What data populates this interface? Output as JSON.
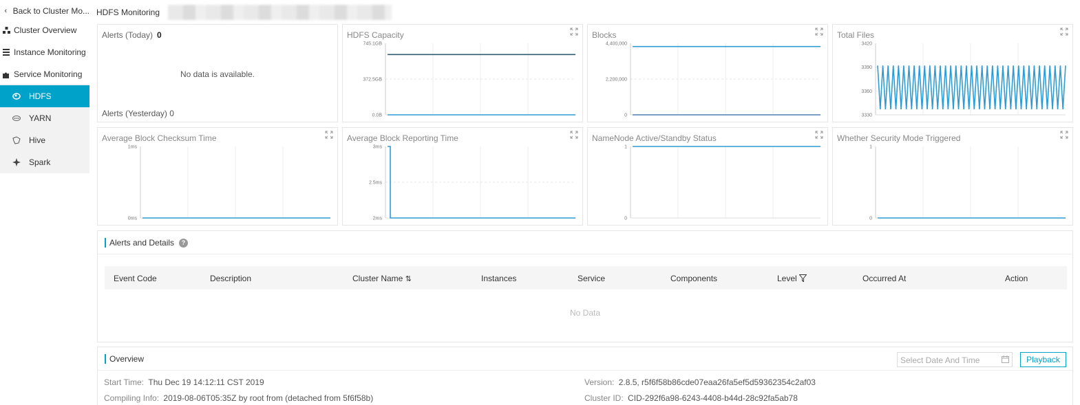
{
  "sidebar": {
    "back": "Back to Cluster Mo...",
    "overview": "Cluster Overview",
    "instance": "Instance Monitoring",
    "service": "Service Monitoring",
    "items": [
      {
        "label": "HDFS",
        "icon": "hdfs-icon"
      },
      {
        "label": "YARN",
        "icon": "yarn-icon"
      },
      {
        "label": "Hive",
        "icon": "hive-icon"
      },
      {
        "label": "Spark",
        "icon": "spark-icon"
      }
    ]
  },
  "header": {
    "title": "HDFS Monitoring"
  },
  "alerts_card": {
    "today_label": "Alerts (Today)",
    "today_value": "0",
    "empty": "No data is available.",
    "yesterday_label": "Alerts (Yesterday)",
    "yesterday_value": "0"
  },
  "chart_data": [
    {
      "type": "line",
      "title": "HDFS Capacity",
      "y_ticks": [
        "745.1GB",
        "372.5GB",
        "0.0B"
      ],
      "ylim": [
        0,
        745.1
      ],
      "series": [
        {
          "color": "#2e5c70",
          "values": [
            628,
            628,
            628,
            628,
            628
          ]
        },
        {
          "color": "#2d9cd6",
          "values": [
            0,
            0,
            0,
            0,
            0
          ]
        }
      ]
    },
    {
      "type": "line",
      "title": "Blocks",
      "y_ticks": [
        "4,400,000",
        "2,200,000",
        "0"
      ],
      "ylim": [
        0,
        4400000
      ],
      "series": [
        {
          "color": "#2d9cd6",
          "values": [
            4200000,
            4200000,
            4200000,
            4200000,
            4200000
          ]
        },
        {
          "color": "#4a7fb0",
          "values": [
            0,
            0,
            0,
            0,
            0
          ]
        }
      ]
    },
    {
      "type": "line",
      "title": "Total Files",
      "y_ticks": [
        "3420",
        "3390",
        "3360",
        "3330"
      ],
      "ylim": [
        3330,
        3420
      ],
      "series": [
        {
          "color": "#2d9cd6",
          "oscillation": {
            "cycles": 36,
            "high": 3392,
            "low": 3337
          }
        }
      ]
    },
    {
      "type": "line",
      "title": "Average Block Checksum Time",
      "y_ticks": [
        "1ms",
        "0ms"
      ],
      "ylim": [
        0,
        1
      ],
      "series": [
        {
          "color": "#2d9cd6",
          "values": [
            0,
            0,
            0,
            0,
            0
          ]
        }
      ]
    },
    {
      "type": "line",
      "title": "Average Block Reporting Time",
      "y_ticks": [
        "3ms",
        "2.5ms",
        "2ms"
      ],
      "ylim": [
        2,
        3
      ],
      "series": [
        {
          "color": "#2d9cd6",
          "values": [
            3,
            2,
            2,
            2,
            2,
            2,
            2,
            2
          ]
        }
      ]
    },
    {
      "type": "line",
      "title": "NameNode Active/Standby Status",
      "y_ticks": [
        "1",
        "0"
      ],
      "ylim": [
        0,
        1
      ],
      "series": [
        {
          "color": "#2d9cd6",
          "values": [
            1,
            1,
            1,
            1,
            1
          ]
        }
      ]
    },
    {
      "type": "line",
      "title": "Whether Security Mode Triggered",
      "y_ticks": [
        "1",
        "0"
      ],
      "ylim": [
        0,
        1
      ],
      "series": [
        {
          "color": "#2d9cd6",
          "values": [
            0,
            0,
            0,
            0,
            0
          ]
        }
      ]
    }
  ],
  "alerts_table": {
    "title": "Alerts and Details",
    "columns": [
      "Event Code",
      "Description",
      "Cluster Name",
      "Instances",
      "Service",
      "Components",
      "Level",
      "Occurred At",
      "Action"
    ],
    "empty": "No Data"
  },
  "overview": {
    "title": "Overview",
    "date_placeholder": "Select Date And Time",
    "playback": "Playback",
    "start_time_label": "Start Time:",
    "start_time": "Thu Dec 19 14:12:11 CST 2019",
    "compiling_label": "Compiling Info:",
    "compiling": "2019-08-06T05:35Z by root from (detached from 5f6f58b)",
    "version_label": "Version:",
    "version": "2.8.5, r5f6f58b86cde07eaa26fa5ef5d59362354c2af03",
    "cluster_id_label": "Cluster ID:",
    "cluster_id": "CID-292f6a98-6243-4408-b44d-28c92fa5ab78"
  },
  "colors": {
    "accent": "#00a2ca",
    "line": "#2d9cd6"
  }
}
